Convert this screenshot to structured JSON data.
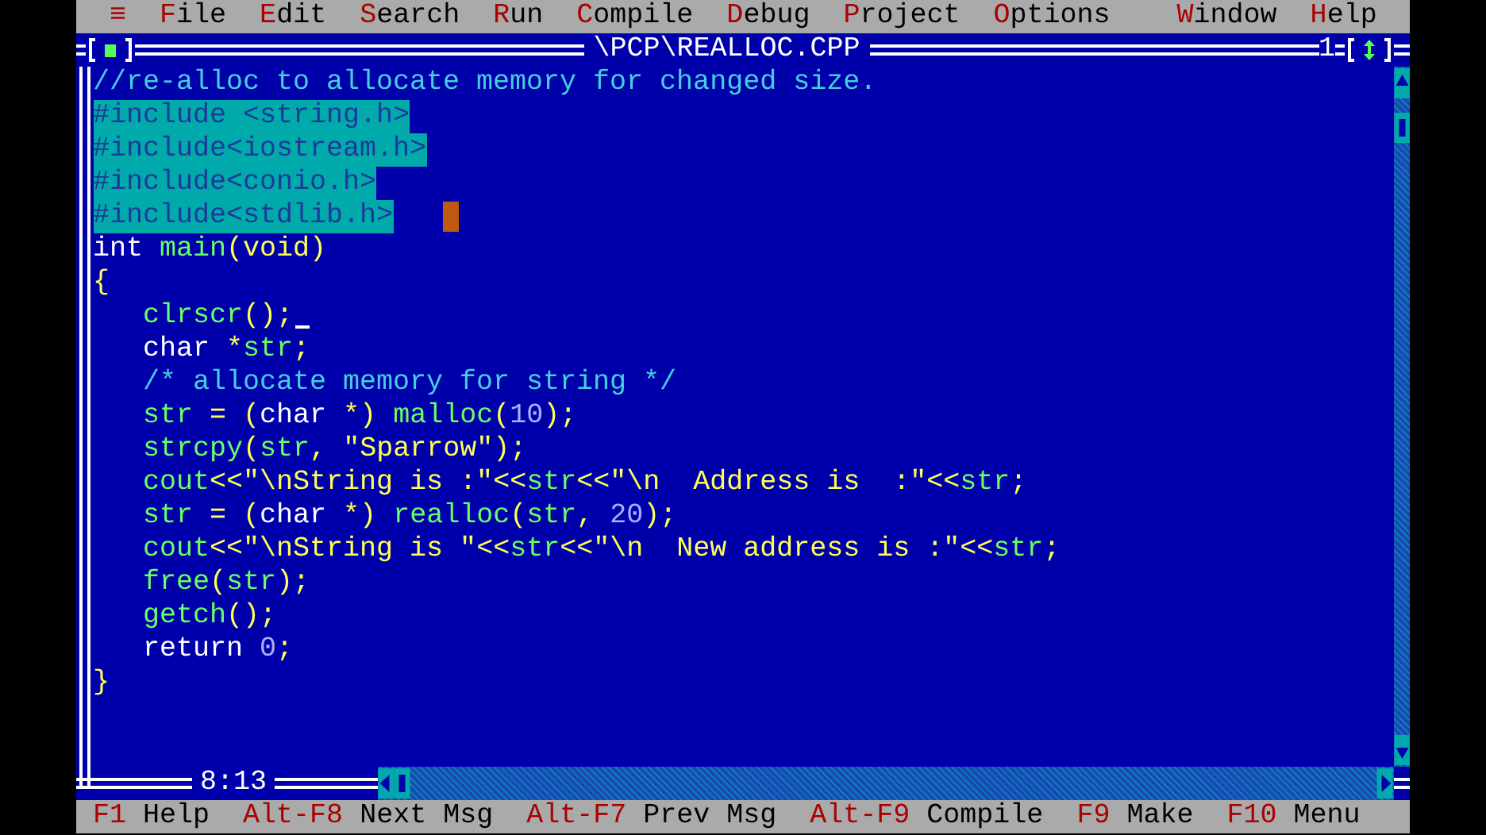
{
  "menu": [
    {
      "label": "≡"
    },
    {
      "label": "File"
    },
    {
      "label": "Edit"
    },
    {
      "label": "Search"
    },
    {
      "label": "Run"
    },
    {
      "label": "Compile"
    },
    {
      "label": "Debug"
    },
    {
      "label": "Project"
    },
    {
      "label": "Options"
    }
  ],
  "menu_right": [
    {
      "label": "Window"
    },
    {
      "label": "Help"
    }
  ],
  "editor": {
    "title": "\\PCP\\REALLOC.CPP",
    "window_number": "1",
    "cursor_position": "8:13",
    "lines": [
      {
        "selected": false,
        "tokens": [
          {
            "text": "//re-alloc to allocate memory for changed size.",
            "kind": "comment"
          }
        ]
      },
      {
        "selected": true,
        "tokens": [
          {
            "text": "#include <string.h>",
            "kind": "directive"
          }
        ]
      },
      {
        "selected": true,
        "tokens": [
          {
            "text": "#include<iostream.h>",
            "kind": "directive"
          }
        ]
      },
      {
        "selected": true,
        "tokens": [
          {
            "text": "#include<conio.h>",
            "kind": "directive"
          }
        ]
      },
      {
        "selected": true,
        "mouse_pointer": true,
        "tokens": [
          {
            "text": "#include<stdlib.h>",
            "kind": "directive"
          }
        ]
      },
      {
        "selected": false,
        "tokens": [
          {
            "text": "int",
            "kind": "keyword"
          },
          {
            "text": " main",
            "kind": "ident"
          },
          {
            "text": "(void)",
            "kind": "sym"
          }
        ]
      },
      {
        "selected": false,
        "tokens": [
          {
            "text": "{",
            "kind": "sym"
          }
        ]
      },
      {
        "selected": false,
        "text_cursor": true,
        "tokens": [
          {
            "text": "   clrscr",
            "kind": "ident"
          },
          {
            "text": "();",
            "kind": "sym"
          }
        ]
      },
      {
        "selected": false,
        "tokens": [
          {
            "text": "   char",
            "kind": "keyword"
          },
          {
            "text": " *",
            "kind": "sym"
          },
          {
            "text": "str",
            "kind": "ident"
          },
          {
            "text": ";",
            "kind": "sym"
          }
        ]
      },
      {
        "selected": false,
        "tokens": [
          {
            "text": "   /* allocate memory for string */",
            "kind": "comment"
          }
        ]
      },
      {
        "selected": false,
        "tokens": [
          {
            "text": "   str",
            "kind": "ident"
          },
          {
            "text": " = (",
            "kind": "sym"
          },
          {
            "text": "char",
            "kind": "keyword"
          },
          {
            "text": " *) ",
            "kind": "sym"
          },
          {
            "text": "malloc",
            "kind": "ident"
          },
          {
            "text": "(",
            "kind": "sym"
          },
          {
            "text": "10",
            "kind": "number"
          },
          {
            "text": ");",
            "kind": "sym"
          }
        ]
      },
      {
        "selected": false,
        "tokens": [
          {
            "text": "   strcpy",
            "kind": "ident"
          },
          {
            "text": "(",
            "kind": "sym"
          },
          {
            "text": "str",
            "kind": "ident"
          },
          {
            "text": ", ",
            "kind": "sym"
          },
          {
            "text": "\"Sparrow\"",
            "kind": "string"
          },
          {
            "text": ");",
            "kind": "sym"
          }
        ]
      },
      {
        "selected": false,
        "tokens": [
          {
            "text": "   cout",
            "kind": "ident"
          },
          {
            "text": "<<",
            "kind": "sym"
          },
          {
            "text": "\"\\nString is :\"",
            "kind": "string"
          },
          {
            "text": "<<",
            "kind": "sym"
          },
          {
            "text": "str",
            "kind": "ident"
          },
          {
            "text": "<<",
            "kind": "sym"
          },
          {
            "text": "\"\\n  Address is  :\"",
            "kind": "string"
          },
          {
            "text": "<<",
            "kind": "sym"
          },
          {
            "text": "str",
            "kind": "ident"
          },
          {
            "text": ";",
            "kind": "sym"
          }
        ]
      },
      {
        "selected": false,
        "tokens": [
          {
            "text": "   str",
            "kind": "ident"
          },
          {
            "text": " = (",
            "kind": "sym"
          },
          {
            "text": "char",
            "kind": "keyword"
          },
          {
            "text": " *) ",
            "kind": "sym"
          },
          {
            "text": "realloc",
            "kind": "ident"
          },
          {
            "text": "(",
            "kind": "sym"
          },
          {
            "text": "str",
            "kind": "ident"
          },
          {
            "text": ", ",
            "kind": "sym"
          },
          {
            "text": "20",
            "kind": "number"
          },
          {
            "text": ");",
            "kind": "sym"
          }
        ]
      },
      {
        "selected": false,
        "tokens": [
          {
            "text": "   cout",
            "kind": "ident"
          },
          {
            "text": "<<",
            "kind": "sym"
          },
          {
            "text": "\"\\nString is \"",
            "kind": "string"
          },
          {
            "text": "<<",
            "kind": "sym"
          },
          {
            "text": "str",
            "kind": "ident"
          },
          {
            "text": "<<",
            "kind": "sym"
          },
          {
            "text": "\"\\n  New address is :\"",
            "kind": "string"
          },
          {
            "text": "<<",
            "kind": "sym"
          },
          {
            "text": "str",
            "kind": "ident"
          },
          {
            "text": ";",
            "kind": "sym"
          }
        ]
      },
      {
        "selected": false,
        "tokens": [
          {
            "text": "   free",
            "kind": "ident"
          },
          {
            "text": "(",
            "kind": "sym"
          },
          {
            "text": "str",
            "kind": "ident"
          },
          {
            "text": ");",
            "kind": "sym"
          }
        ]
      },
      {
        "selected": false,
        "tokens": [
          {
            "text": "   getch",
            "kind": "ident"
          },
          {
            "text": "();",
            "kind": "sym"
          }
        ]
      },
      {
        "selected": false,
        "tokens": [
          {
            "text": "   return",
            "kind": "keyword"
          },
          {
            "text": " 0",
            "kind": "number"
          },
          {
            "text": ";",
            "kind": "sym"
          }
        ]
      },
      {
        "selected": false,
        "tokens": [
          {
            "text": "}",
            "kind": "sym"
          }
        ]
      }
    ]
  },
  "status_bar": [
    {
      "key": "F1",
      "label": "Help"
    },
    {
      "key": "Alt-F8",
      "label": "Next Msg"
    },
    {
      "key": "Alt-F7",
      "label": "Prev Msg"
    },
    {
      "key": "Alt-F9",
      "label": "Compile"
    },
    {
      "key": "F9",
      "label": "Make"
    },
    {
      "key": "F10",
      "label": "Menu"
    }
  ]
}
